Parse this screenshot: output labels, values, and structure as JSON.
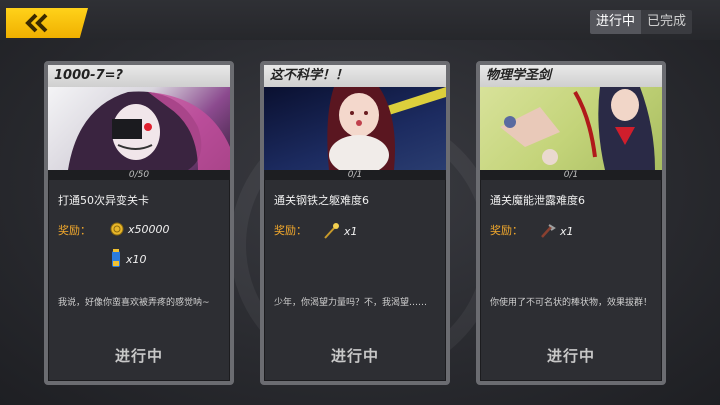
{
  "tabs": [
    {
      "label": "进行中",
      "active": true
    },
    {
      "label": "已完成",
      "active": false
    }
  ],
  "cards": [
    {
      "title": "1000-7=?",
      "progress": "0/50",
      "task": "打通50次异变关卡",
      "reward_label": "奖励：",
      "rewards": [
        {
          "icon": "gold-coin-icon",
          "amount": "x50000"
        },
        {
          "icon": "energy-potion-icon",
          "amount": "x10"
        }
      ],
      "description": "我说，好像你蛮喜欢被弄疼的感觉呐~",
      "status": "进行中"
    },
    {
      "title": "这不科学！！",
      "progress": "0/1",
      "task": "通关钢铁之躯难度6",
      "reward_label": "奖励：",
      "rewards": [
        {
          "icon": "golden-staff-icon",
          "amount": "x1"
        }
      ],
      "description": "少年，你渴望力量吗？不，我渴望……",
      "status": "进行中"
    },
    {
      "title": "物理学圣剑",
      "progress": "0/1",
      "task": "通关魔能泄露难度6",
      "reward_label": "奖励：",
      "rewards": [
        {
          "icon": "crowbar-icon",
          "amount": "x1"
        }
      ],
      "description": "你使用了不可名状的棒状物，效果拔群！",
      "status": "进行中"
    }
  ],
  "colors": {
    "back_button": "#f5c400",
    "reward_label": "#f3a92c",
    "card_border": "#6b6c71"
  }
}
